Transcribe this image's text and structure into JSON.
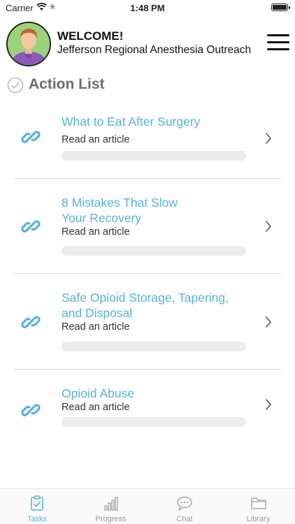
{
  "status_bar": {
    "carrier": "Carrier",
    "time": "1:48 PM",
    "wifi_icon": "wifi-icon",
    "battery_icon": "battery-icon"
  },
  "header": {
    "welcome": "WELCOME!",
    "organization": "Jefferson Regional Anesthesia Outreach",
    "avatar_icon": "user-avatar",
    "menu_icon": "hamburger-menu-icon"
  },
  "section": {
    "title": "Action List",
    "icon": "checkmark-circle-icon"
  },
  "items": [
    {
      "title_lines": [
        "What to Eat After Surgery"
      ],
      "subtitle": "Read an article",
      "progress": 0
    },
    {
      "title_lines": [
        "8 Mistakes That Slow",
        "Your Recovery"
      ],
      "subtitle": "Read an article",
      "progress": 0
    },
    {
      "title_lines": [
        "Safe Opioid Storage, Tapering,",
        "and Disposal"
      ],
      "subtitle": "Read an article",
      "progress": 0
    },
    {
      "title_lines": [
        "Opioid Abuse"
      ],
      "subtitle": "Read an article",
      "progress": 0
    }
  ],
  "tabs": [
    {
      "label": "Tasks",
      "icon": "clipboard-check-icon",
      "active": true
    },
    {
      "label": "Progress",
      "icon": "bar-chart-icon",
      "active": false
    },
    {
      "label": "Chat",
      "icon": "chat-bubble-icon",
      "active": false
    },
    {
      "label": "Library",
      "icon": "folder-icon",
      "active": false
    }
  ],
  "colors": {
    "accent": "#58b4d6",
    "muted_text": "#6d6d6d",
    "progress_track": "#ececec",
    "avatar_bg": "#9cd27a"
  }
}
